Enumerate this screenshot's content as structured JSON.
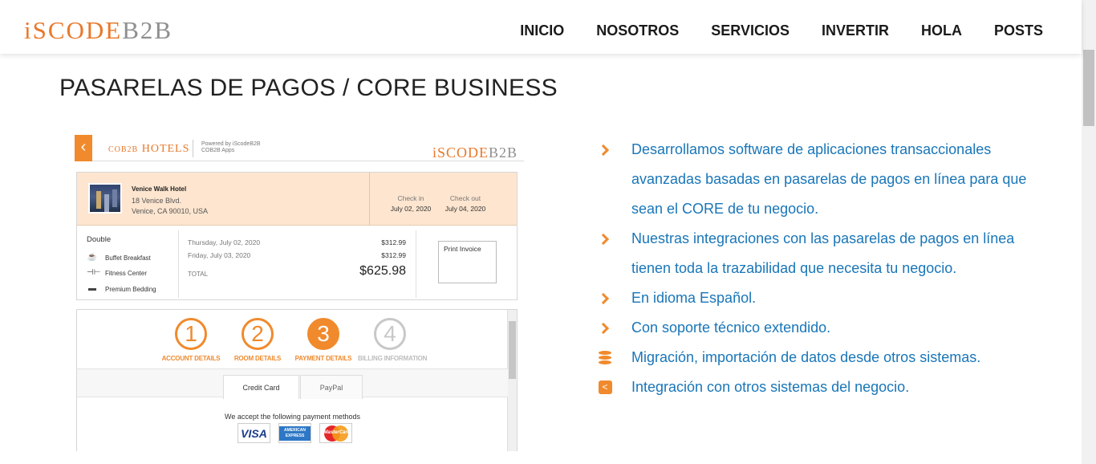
{
  "header": {
    "logo_part1": "iSCODE",
    "logo_part2": "B2B",
    "nav": [
      "INICIO",
      "NOSOTROS",
      "SERVICIOS",
      "INVERTIR",
      "HOLA",
      "POSTS"
    ]
  },
  "page_title": "PASARELAS DE PAGOS / CORE BUSINESS",
  "mock": {
    "back_glyph": "‹",
    "brand_small": "COB2B",
    "brand_big": "HOTELS",
    "powered": "Powered by iScodeB2B\nCOB2B Apps",
    "logo_part1": "iSCODE",
    "logo_part2": "B2B",
    "hotel_name": "Venice Walk Hotel",
    "hotel_addr1": "18 Venice Blvd.",
    "hotel_addr2": "Venice, CA 90010, USA",
    "checkin_label": "Check in",
    "checkin_date": "July 02, 2020",
    "checkout_label": "Check out",
    "checkout_date": "July 04, 2020",
    "room_type": "Double",
    "amenities": [
      "Buffet Breakfast",
      "Fitness Center",
      "Premium Bedding"
    ],
    "night1": "Thursday, July 02, 2020",
    "night2": "Friday, July 03, 2020",
    "total_label": "TOTAL",
    "price1": "$312.99",
    "price2": "$312.99",
    "total": "$625.98",
    "print_invoice": "Print Invoice",
    "steps": [
      {
        "num": "1",
        "label": "ACCOUNT DETAILS"
      },
      {
        "num": "2",
        "label": "ROOM DETAILS"
      },
      {
        "num": "3",
        "label": "PAYMENT DETAILS"
      },
      {
        "num": "4",
        "label": "BILLING INFORMATION"
      }
    ],
    "tab_credit": "Credit Card",
    "tab_paypal": "PayPal",
    "accept_text": "We accept the following payment methods",
    "card_visa": "VISA",
    "card_amex": "AMERICAN EXPRESS",
    "card_mc": "MasterCard"
  },
  "features": [
    {
      "icon": "chevron-right-icon",
      "text": "Desarrollamos software de aplicaciones transaccionales avanzadas basadas en pasarelas de pagos en línea para que sean el CORE de tu negocio."
    },
    {
      "icon": "chevron-right-icon",
      "text": "Nuestras integraciones con las pasarelas de pagos en línea tienen toda la trazabilidad que necesita tu negocio."
    },
    {
      "icon": "chevron-right-icon",
      "text": "En idioma Español."
    },
    {
      "icon": "chevron-right-icon",
      "text": "Con soporte técnico extendido."
    },
    {
      "icon": "database-icon",
      "text": "Migración, importación de datos desde otros sistemas."
    },
    {
      "icon": "share-icon",
      "text": "Integración con otros sistemas del negocio."
    }
  ],
  "colors": {
    "accent": "#f08a2d",
    "link": "#1976b8"
  }
}
